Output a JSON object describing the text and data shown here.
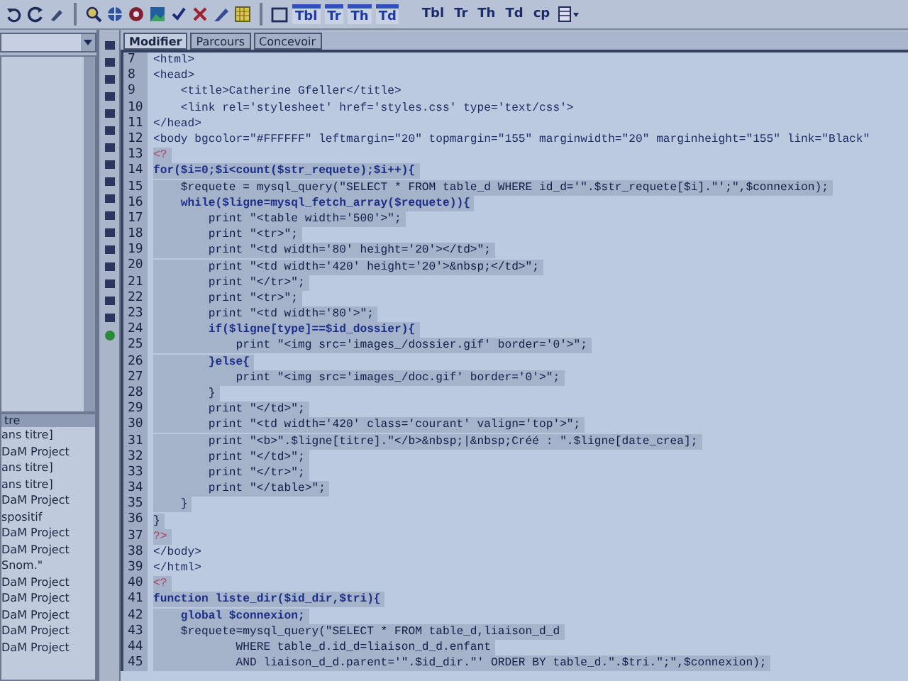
{
  "toolbar": {
    "tools": [
      "Tbl",
      "Tr",
      "Th",
      "Td"
    ],
    "text_tools": [
      "Tbl",
      "Tr",
      "Th",
      "Td",
      "cp"
    ]
  },
  "tabs": [
    {
      "label": "Modifier",
      "selected": true
    },
    {
      "label": "Parcours",
      "selected": false
    },
    {
      "label": "Concevoir",
      "selected": false
    }
  ],
  "left_panel": {
    "list_header": "tre",
    "items": [
      "ans titre]",
      "DaM Project",
      "ans titre]",
      "ans titre]",
      "DaM Project",
      "spositif",
      "DaM Project",
      "DaM Project",
      "Snom.\"",
      "DaM Project",
      "DaM Project",
      "DaM Project",
      "DaM Project",
      "DaM Project"
    ]
  },
  "editor": {
    "lines": [
      {
        "number": "7",
        "text": "<html>",
        "kind": "html",
        "selected": false
      },
      {
        "number": "8",
        "text": "<head>",
        "kind": "html",
        "selected": false
      },
      {
        "number": "9",
        "text": "    <title>Catherine Gfeller</title>",
        "kind": "html",
        "selected": false
      },
      {
        "number": "10",
        "text": "    <link rel='stylesheet' href='styles.css' type='text/css'>",
        "kind": "html",
        "selected": false
      },
      {
        "number": "11",
        "text": "</head>",
        "kind": "html",
        "selected": false
      },
      {
        "number": "12",
        "text": "<body bgcolor=\"#FFFFFF\" leftmargin=\"20\" topmargin=\"155\" marginwidth=\"20\" marginheight=\"155\" link=\"Black\"",
        "kind": "html",
        "selected": false
      },
      {
        "number": "13",
        "text": "<?",
        "kind": "php_tag",
        "selected": true
      },
      {
        "number": "14",
        "text": "for($i=0;$i<count($str_requete);$i++){",
        "kind": "keyword",
        "selected": true
      },
      {
        "number": "15",
        "text": "    $requete = mysql_query(\"SELECT * FROM table_d WHERE id_d='\".$str_requete[$i].\"';\",$connexion);",
        "kind": "code",
        "selected": true
      },
      {
        "number": "16",
        "text": "    while($ligne=mysql_fetch_array($requete)){",
        "kind": "keyword",
        "selected": true
      },
      {
        "number": "17",
        "text": "        print \"<table width='500'>\";",
        "kind": "code",
        "selected": true
      },
      {
        "number": "18",
        "text": "        print \"<tr>\";",
        "kind": "code",
        "selected": true
      },
      {
        "number": "19",
        "text": "        print \"<td width='80' height='20'></td>\";",
        "kind": "code",
        "selected": true
      },
      {
        "number": "20",
        "text": "        print \"<td width='420' height='20'>&nbsp;</td>\";",
        "kind": "code",
        "selected": true
      },
      {
        "number": "21",
        "text": "        print \"</tr>\";",
        "kind": "code",
        "selected": true
      },
      {
        "number": "22",
        "text": "        print \"<tr>\";",
        "kind": "code",
        "selected": true
      },
      {
        "number": "23",
        "text": "        print \"<td width='80'>\";",
        "kind": "code",
        "selected": true
      },
      {
        "number": "24",
        "text": "        if($ligne[type]==$id_dossier){",
        "kind": "keyword",
        "selected": true
      },
      {
        "number": "25",
        "text": "            print \"<img src='images_/dossier.gif' border='0'>\";",
        "kind": "code",
        "selected": true
      },
      {
        "number": "26",
        "text": "        }else{",
        "kind": "keyword",
        "selected": true
      },
      {
        "number": "27",
        "text": "            print \"<img src='images_/doc.gif' border='0'>\";",
        "kind": "code",
        "selected": true
      },
      {
        "number": "28",
        "text": "        }",
        "kind": "code",
        "selected": true
      },
      {
        "number": "29",
        "text": "        print \"</td>\";",
        "kind": "code",
        "selected": true
      },
      {
        "number": "30",
        "text": "        print \"<td width='420' class='courant' valign='top'>\";",
        "kind": "code",
        "selected": true
      },
      {
        "number": "31",
        "text": "        print \"<b>\".$ligne[titre].\"</b>&nbsp;|&nbsp;Créé : \".$ligne[date_crea];",
        "kind": "code",
        "selected": true
      },
      {
        "number": "32",
        "text": "        print \"</td>\";",
        "kind": "code",
        "selected": true
      },
      {
        "number": "33",
        "text": "        print \"</tr>\";",
        "kind": "code",
        "selected": true
      },
      {
        "number": "34",
        "text": "        print \"</table>\";",
        "kind": "code",
        "selected": true
      },
      {
        "number": "35",
        "text": "    }",
        "kind": "code",
        "selected": true
      },
      {
        "number": "36",
        "text": "}",
        "kind": "code",
        "selected": true
      },
      {
        "number": "37",
        "text": "?>",
        "kind": "php_tag",
        "selected": true
      },
      {
        "number": "38",
        "text": "</body>",
        "kind": "html",
        "selected": false
      },
      {
        "number": "39",
        "text": "</html>",
        "kind": "html",
        "selected": false
      },
      {
        "number": "40",
        "text": "<?",
        "kind": "php_tag",
        "selected": true
      },
      {
        "number": "41",
        "text": "function liste_dir($id_dir,$tri){",
        "kind": "keyword",
        "selected": true
      },
      {
        "number": "42",
        "text": "    global $connexion;",
        "kind": "keyword",
        "selected": true
      },
      {
        "number": "43",
        "text": "    $requete=mysql_query(\"SELECT * FROM table_d,liaison_d_d",
        "kind": "code",
        "selected": true
      },
      {
        "number": "44",
        "text": "            WHERE table_d.id_d=liaison_d_d.enfant",
        "kind": "code",
        "selected": true
      },
      {
        "number": "45",
        "text": "            AND liaison_d_d.parent='\".$id_dir.\"' ORDER BY table_d.\".$tri.\";\",$connexion);",
        "kind": "code",
        "selected": true
      }
    ]
  }
}
